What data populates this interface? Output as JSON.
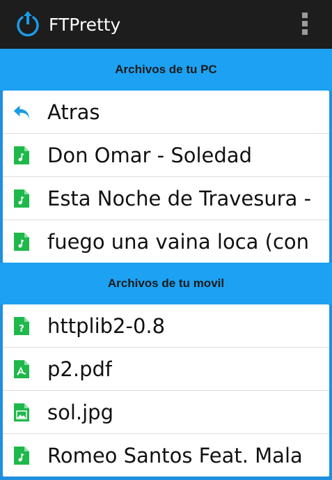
{
  "app": {
    "title": "FTPretty"
  },
  "pc_section": {
    "header": "Archivos de tu PC",
    "items": [
      {
        "label": "Atras",
        "icon": "back-arrow-icon"
      },
      {
        "label": "Don Omar - Soledad",
        "icon": "audio-file-icon"
      },
      {
        "label": "Esta Noche de Travesura -",
        "icon": "audio-file-icon"
      },
      {
        "label": "fuego una vaina loca (con",
        "icon": "audio-file-icon"
      }
    ]
  },
  "mobile_section": {
    "header": "Archivos de tu movil",
    "items": [
      {
        "label": "httplib2-0.8",
        "icon": "unknown-file-icon"
      },
      {
        "label": "p2.pdf",
        "icon": "pdf-file-icon"
      },
      {
        "label": "sol.jpg",
        "icon": "image-file-icon"
      },
      {
        "label": "Romeo Santos Feat. Mala",
        "icon": "audio-file-icon"
      }
    ]
  },
  "colors": {
    "actionbar": "#1d1d1d",
    "section_header": "#1da1f2",
    "file_icon_green": "#1fb84a",
    "back_arrow_blue": "#1a9be6"
  }
}
